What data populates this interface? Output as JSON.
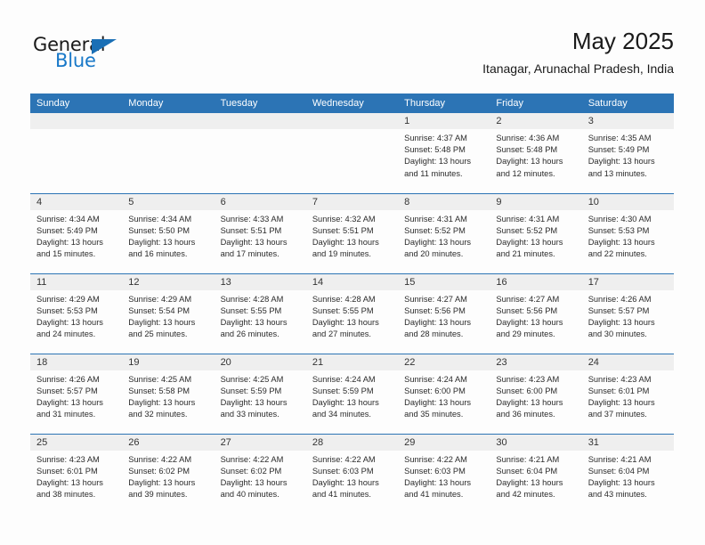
{
  "logo": {
    "word_one": "General",
    "word_two": "Blue",
    "triangle_icon": "triangle-icon"
  },
  "header": {
    "month_title": "May 2025",
    "location": "Itanagar, Arunachal Pradesh, India"
  },
  "colors": {
    "header_blue": "#2c74b5",
    "band_gray": "#efefef",
    "logo_blue": "#1878c8"
  },
  "calendar": {
    "weekday_headers": [
      "Sunday",
      "Monday",
      "Tuesday",
      "Wednesday",
      "Thursday",
      "Friday",
      "Saturday"
    ],
    "weeks": [
      [
        {
          "day": "",
          "empty": true,
          "sunrise": "",
          "sunset": "",
          "daylight_l1": "",
          "daylight_l2": ""
        },
        {
          "day": "",
          "empty": true,
          "sunrise": "",
          "sunset": "",
          "daylight_l1": "",
          "daylight_l2": ""
        },
        {
          "day": "",
          "empty": true,
          "sunrise": "",
          "sunset": "",
          "daylight_l1": "",
          "daylight_l2": ""
        },
        {
          "day": "",
          "empty": true,
          "sunrise": "",
          "sunset": "",
          "daylight_l1": "",
          "daylight_l2": ""
        },
        {
          "day": "1",
          "empty": false,
          "sunrise": "Sunrise: 4:37 AM",
          "sunset": "Sunset: 5:48 PM",
          "daylight_l1": "Daylight: 13 hours",
          "daylight_l2": "and 11 minutes."
        },
        {
          "day": "2",
          "empty": false,
          "sunrise": "Sunrise: 4:36 AM",
          "sunset": "Sunset: 5:48 PM",
          "daylight_l1": "Daylight: 13 hours",
          "daylight_l2": "and 12 minutes."
        },
        {
          "day": "3",
          "empty": false,
          "sunrise": "Sunrise: 4:35 AM",
          "sunset": "Sunset: 5:49 PM",
          "daylight_l1": "Daylight: 13 hours",
          "daylight_l2": "and 13 minutes."
        }
      ],
      [
        {
          "day": "4",
          "empty": false,
          "sunrise": "Sunrise: 4:34 AM",
          "sunset": "Sunset: 5:49 PM",
          "daylight_l1": "Daylight: 13 hours",
          "daylight_l2": "and 15 minutes."
        },
        {
          "day": "5",
          "empty": false,
          "sunrise": "Sunrise: 4:34 AM",
          "sunset": "Sunset: 5:50 PM",
          "daylight_l1": "Daylight: 13 hours",
          "daylight_l2": "and 16 minutes."
        },
        {
          "day": "6",
          "empty": false,
          "sunrise": "Sunrise: 4:33 AM",
          "sunset": "Sunset: 5:51 PM",
          "daylight_l1": "Daylight: 13 hours",
          "daylight_l2": "and 17 minutes."
        },
        {
          "day": "7",
          "empty": false,
          "sunrise": "Sunrise: 4:32 AM",
          "sunset": "Sunset: 5:51 PM",
          "daylight_l1": "Daylight: 13 hours",
          "daylight_l2": "and 19 minutes."
        },
        {
          "day": "8",
          "empty": false,
          "sunrise": "Sunrise: 4:31 AM",
          "sunset": "Sunset: 5:52 PM",
          "daylight_l1": "Daylight: 13 hours",
          "daylight_l2": "and 20 minutes."
        },
        {
          "day": "9",
          "empty": false,
          "sunrise": "Sunrise: 4:31 AM",
          "sunset": "Sunset: 5:52 PM",
          "daylight_l1": "Daylight: 13 hours",
          "daylight_l2": "and 21 minutes."
        },
        {
          "day": "10",
          "empty": false,
          "sunrise": "Sunrise: 4:30 AM",
          "sunset": "Sunset: 5:53 PM",
          "daylight_l1": "Daylight: 13 hours",
          "daylight_l2": "and 22 minutes."
        }
      ],
      [
        {
          "day": "11",
          "empty": false,
          "sunrise": "Sunrise: 4:29 AM",
          "sunset": "Sunset: 5:53 PM",
          "daylight_l1": "Daylight: 13 hours",
          "daylight_l2": "and 24 minutes."
        },
        {
          "day": "12",
          "empty": false,
          "sunrise": "Sunrise: 4:29 AM",
          "sunset": "Sunset: 5:54 PM",
          "daylight_l1": "Daylight: 13 hours",
          "daylight_l2": "and 25 minutes."
        },
        {
          "day": "13",
          "empty": false,
          "sunrise": "Sunrise: 4:28 AM",
          "sunset": "Sunset: 5:55 PM",
          "daylight_l1": "Daylight: 13 hours",
          "daylight_l2": "and 26 minutes."
        },
        {
          "day": "14",
          "empty": false,
          "sunrise": "Sunrise: 4:28 AM",
          "sunset": "Sunset: 5:55 PM",
          "daylight_l1": "Daylight: 13 hours",
          "daylight_l2": "and 27 minutes."
        },
        {
          "day": "15",
          "empty": false,
          "sunrise": "Sunrise: 4:27 AM",
          "sunset": "Sunset: 5:56 PM",
          "daylight_l1": "Daylight: 13 hours",
          "daylight_l2": "and 28 minutes."
        },
        {
          "day": "16",
          "empty": false,
          "sunrise": "Sunrise: 4:27 AM",
          "sunset": "Sunset: 5:56 PM",
          "daylight_l1": "Daylight: 13 hours",
          "daylight_l2": "and 29 minutes."
        },
        {
          "day": "17",
          "empty": false,
          "sunrise": "Sunrise: 4:26 AM",
          "sunset": "Sunset: 5:57 PM",
          "daylight_l1": "Daylight: 13 hours",
          "daylight_l2": "and 30 minutes."
        }
      ],
      [
        {
          "day": "18",
          "empty": false,
          "sunrise": "Sunrise: 4:26 AM",
          "sunset": "Sunset: 5:57 PM",
          "daylight_l1": "Daylight: 13 hours",
          "daylight_l2": "and 31 minutes."
        },
        {
          "day": "19",
          "empty": false,
          "sunrise": "Sunrise: 4:25 AM",
          "sunset": "Sunset: 5:58 PM",
          "daylight_l1": "Daylight: 13 hours",
          "daylight_l2": "and 32 minutes."
        },
        {
          "day": "20",
          "empty": false,
          "sunrise": "Sunrise: 4:25 AM",
          "sunset": "Sunset: 5:59 PM",
          "daylight_l1": "Daylight: 13 hours",
          "daylight_l2": "and 33 minutes."
        },
        {
          "day": "21",
          "empty": false,
          "sunrise": "Sunrise: 4:24 AM",
          "sunset": "Sunset: 5:59 PM",
          "daylight_l1": "Daylight: 13 hours",
          "daylight_l2": "and 34 minutes."
        },
        {
          "day": "22",
          "empty": false,
          "sunrise": "Sunrise: 4:24 AM",
          "sunset": "Sunset: 6:00 PM",
          "daylight_l1": "Daylight: 13 hours",
          "daylight_l2": "and 35 minutes."
        },
        {
          "day": "23",
          "empty": false,
          "sunrise": "Sunrise: 4:23 AM",
          "sunset": "Sunset: 6:00 PM",
          "daylight_l1": "Daylight: 13 hours",
          "daylight_l2": "and 36 minutes."
        },
        {
          "day": "24",
          "empty": false,
          "sunrise": "Sunrise: 4:23 AM",
          "sunset": "Sunset: 6:01 PM",
          "daylight_l1": "Daylight: 13 hours",
          "daylight_l2": "and 37 minutes."
        }
      ],
      [
        {
          "day": "25",
          "empty": false,
          "sunrise": "Sunrise: 4:23 AM",
          "sunset": "Sunset: 6:01 PM",
          "daylight_l1": "Daylight: 13 hours",
          "daylight_l2": "and 38 minutes."
        },
        {
          "day": "26",
          "empty": false,
          "sunrise": "Sunrise: 4:22 AM",
          "sunset": "Sunset: 6:02 PM",
          "daylight_l1": "Daylight: 13 hours",
          "daylight_l2": "and 39 minutes."
        },
        {
          "day": "27",
          "empty": false,
          "sunrise": "Sunrise: 4:22 AM",
          "sunset": "Sunset: 6:02 PM",
          "daylight_l1": "Daylight: 13 hours",
          "daylight_l2": "and 40 minutes."
        },
        {
          "day": "28",
          "empty": false,
          "sunrise": "Sunrise: 4:22 AM",
          "sunset": "Sunset: 6:03 PM",
          "daylight_l1": "Daylight: 13 hours",
          "daylight_l2": "and 41 minutes."
        },
        {
          "day": "29",
          "empty": false,
          "sunrise": "Sunrise: 4:22 AM",
          "sunset": "Sunset: 6:03 PM",
          "daylight_l1": "Daylight: 13 hours",
          "daylight_l2": "and 41 minutes."
        },
        {
          "day": "30",
          "empty": false,
          "sunrise": "Sunrise: 4:21 AM",
          "sunset": "Sunset: 6:04 PM",
          "daylight_l1": "Daylight: 13 hours",
          "daylight_l2": "and 42 minutes."
        },
        {
          "day": "31",
          "empty": false,
          "sunrise": "Sunrise: 4:21 AM",
          "sunset": "Sunset: 6:04 PM",
          "daylight_l1": "Daylight: 13 hours",
          "daylight_l2": "and 43 minutes."
        }
      ]
    ]
  }
}
